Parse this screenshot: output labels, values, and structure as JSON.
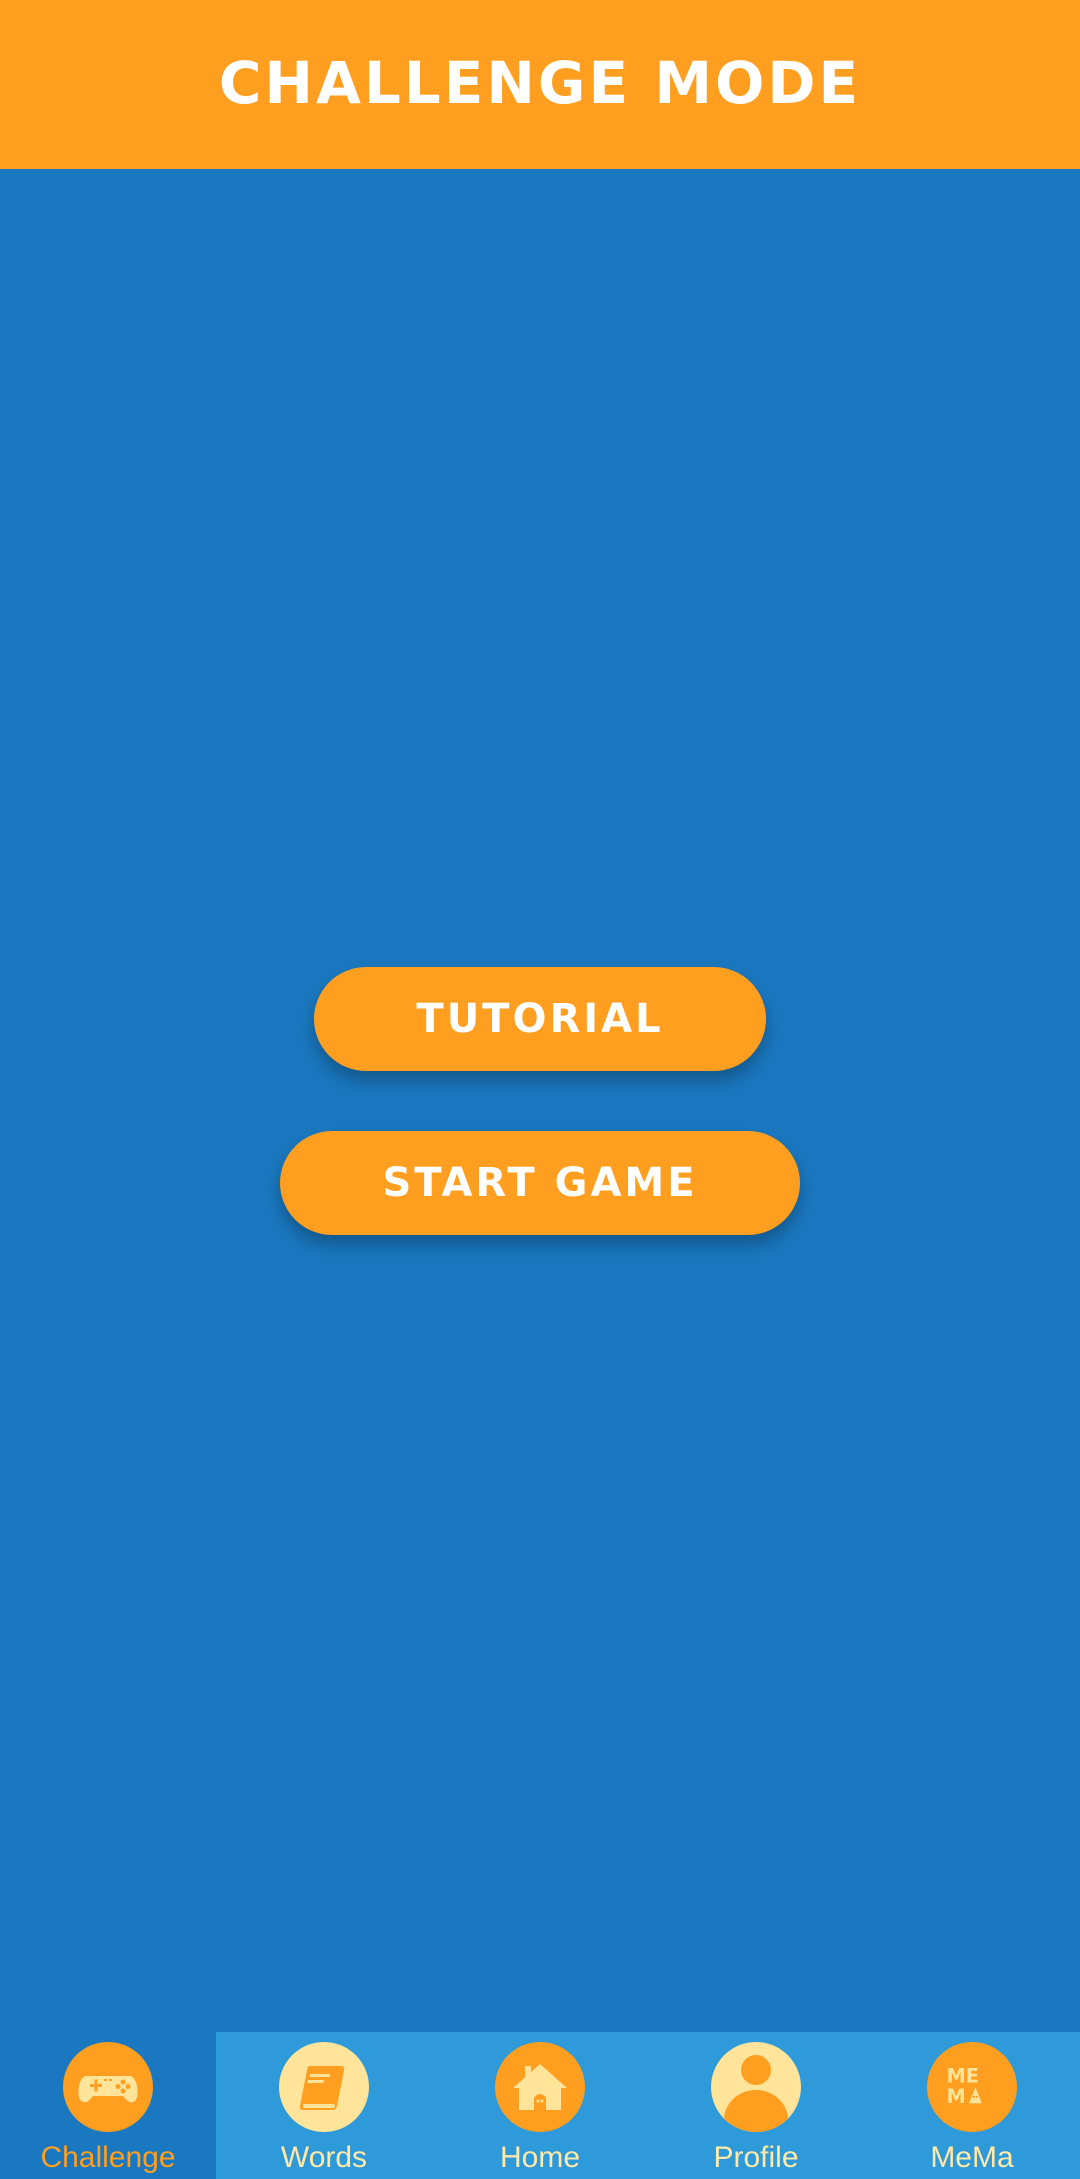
{
  "header": {
    "title": "CHALLENGE MODE"
  },
  "main": {
    "tutorial_label": "TUTORIAL",
    "start_label": "START GAME"
  },
  "tabbar": {
    "tabs": [
      {
        "label": "Challenge",
        "icon": "gamepad-icon",
        "active": true
      },
      {
        "label": "Words",
        "icon": "book-icon",
        "active": false
      },
      {
        "label": "Home",
        "icon": "home-icon",
        "active": false
      },
      {
        "label": "Profile",
        "icon": "profile-icon",
        "active": false
      },
      {
        "label": "MeMa",
        "icon": "mema-logo-icon",
        "active": false
      }
    ]
  },
  "colors": {
    "background": "#1a78c0",
    "header": "#ff9e1f",
    "button": "#ff9e1f",
    "tabbar": "#2e9ad9",
    "tab_active": "#1a78c0",
    "tab_label": "#ffe9a8",
    "tab_label_active": "#ff9e1f",
    "icon_cream": "#ffe49a"
  }
}
